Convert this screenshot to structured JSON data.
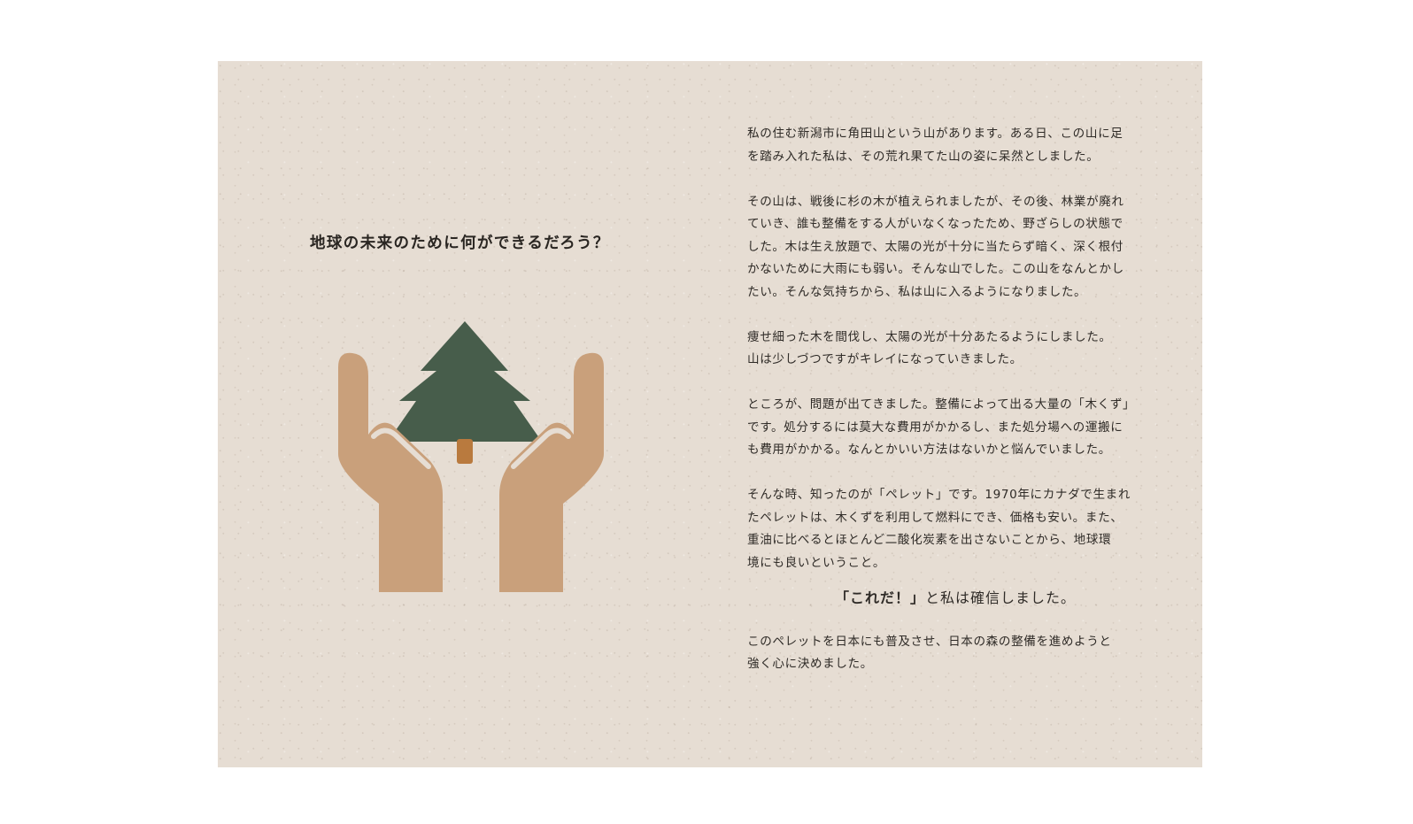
{
  "headline": "地球の未来のために何ができるだろう？",
  "illustration": {
    "icon": "hands-holding-tree-icon",
    "colors": {
      "tree": "#475d4b",
      "trunk": "#b97a3e",
      "hands": "#c9a07b",
      "background": "#e6ddd3"
    }
  },
  "paragraphs": [
    "私の住む新潟市に角田山という山があります。ある日、この山に足\nを踏み入れた私は、その荒れ果てた山の姿に呆然としました。",
    "その山は、戦後に杉の木が植えられましたが、その後、林業が廃れ\nていき、誰も整備をする人がいなくなったため、野ざらしの状態で\nした。木は生え放題で、太陽の光が十分に当たらず暗く、深く根付\nかないために大雨にも弱い。そんな山でした。この山をなんとかし\nたい。そんな気持ちから、私は山に入るようになりました。",
    "痩せ細った木を間伐し、太陽の光が十分あたるようにしました。\n山は少しづつですがキレイになっていきました。",
    "ところが、問題が出てきました。整備によって出る大量の「木くず」\nです。処分するには莫大な費用がかかるし、また処分場への運搬に\nも費用がかかる。なんとかいい方法はないかと悩んでいました。",
    "そんな時、知ったのが「ペレット」です。1970年にカナダで生まれ\nたペレットは、木くずを利用して燃料にでき、価格も安い。また、\n重油に比べるとほとんど二酸化炭素を出さないことから、地球環\n境にも良いということ。"
  ],
  "callout": {
    "strong": "「これだ！」",
    "rest": "と私は確信しました。"
  },
  "closing": "このペレットを日本にも普及させ、日本の森の整備を進めようと\n強く心に決めました。"
}
